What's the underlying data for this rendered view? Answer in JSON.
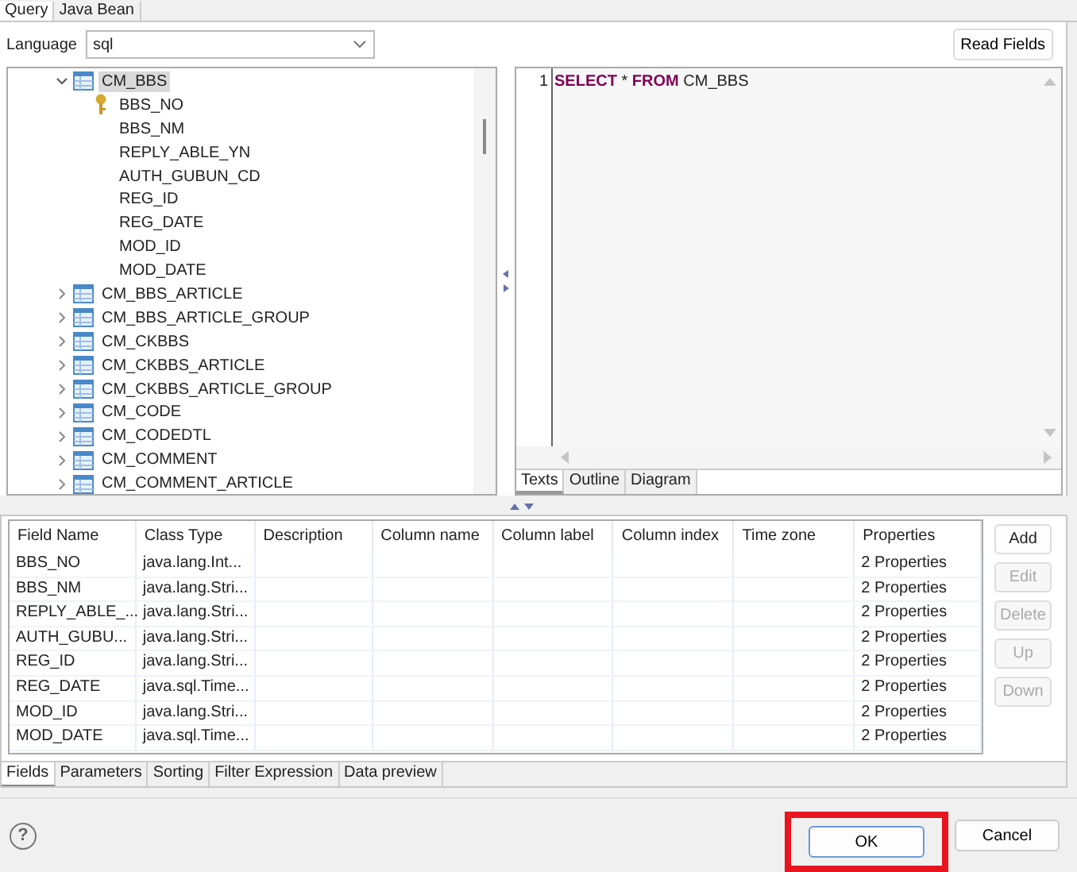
{
  "top_tabs": [
    {
      "label": "Query",
      "selected": true
    },
    {
      "label": "Java Bean",
      "selected": false
    }
  ],
  "language": {
    "label": "Language",
    "value": "sql"
  },
  "read_fields_button": "Read Fields",
  "tree": [
    {
      "label": "CM_BBS",
      "kind": "table",
      "expanded": true,
      "selected": true,
      "children": [
        {
          "label": "BBS_NO",
          "kind": "column",
          "key": true
        },
        {
          "label": "BBS_NM",
          "kind": "column",
          "key": false
        },
        {
          "label": "REPLY_ABLE_YN",
          "kind": "column",
          "key": false
        },
        {
          "label": "AUTH_GUBUN_CD",
          "kind": "column",
          "key": false
        },
        {
          "label": "REG_ID",
          "kind": "column",
          "key": false
        },
        {
          "label": "REG_DATE",
          "kind": "column",
          "key": false
        },
        {
          "label": "MOD_ID",
          "kind": "column",
          "key": false
        },
        {
          "label": "MOD_DATE",
          "kind": "column",
          "key": false
        }
      ]
    },
    {
      "label": "CM_BBS_ARTICLE",
      "kind": "table",
      "expanded": false,
      "selected": false
    },
    {
      "label": "CM_BBS_ARTICLE_GROUP",
      "kind": "table",
      "expanded": false,
      "selected": false
    },
    {
      "label": "CM_CKBBS",
      "kind": "table",
      "expanded": false,
      "selected": false
    },
    {
      "label": "CM_CKBBS_ARTICLE",
      "kind": "table",
      "expanded": false,
      "selected": false
    },
    {
      "label": "CM_CKBBS_ARTICLE_GROUP",
      "kind": "table",
      "expanded": false,
      "selected": false
    },
    {
      "label": "CM_CODE",
      "kind": "table",
      "expanded": false,
      "selected": false
    },
    {
      "label": "CM_CODEDTL",
      "kind": "table",
      "expanded": false,
      "selected": false
    },
    {
      "label": "CM_COMMENT",
      "kind": "table",
      "expanded": false,
      "selected": false
    },
    {
      "label": "CM_COMMENT_ARTICLE",
      "kind": "table",
      "expanded": false,
      "selected": false
    }
  ],
  "editor": {
    "lines": [
      {
        "number": "1",
        "tokens": [
          {
            "text": "SELECT",
            "kind": "keyword"
          },
          {
            "text": " * ",
            "kind": "plain"
          },
          {
            "text": "FROM",
            "kind": "keyword"
          },
          {
            "text": " CM_BBS",
            "kind": "plain"
          }
        ]
      }
    ],
    "tabs": [
      {
        "label": "Texts",
        "selected": true
      },
      {
        "label": "Outline",
        "selected": false
      },
      {
        "label": "Diagram",
        "selected": false
      }
    ]
  },
  "fields_table": {
    "columns": [
      "Field Name",
      "Class Type",
      "Description",
      "Column name",
      "Column label",
      "Column index",
      "Time zone",
      "Properties"
    ],
    "rows": [
      [
        "BBS_NO",
        "java.lang.Int...",
        "",
        "",
        "",
        "",
        "",
        "2 Properties"
      ],
      [
        "BBS_NM",
        "java.lang.Stri...",
        "",
        "",
        "",
        "",
        "",
        "2 Properties"
      ],
      [
        "REPLY_ABLE_...",
        "java.lang.Stri...",
        "",
        "",
        "",
        "",
        "",
        "2 Properties"
      ],
      [
        "AUTH_GUBU...",
        "java.lang.Stri...",
        "",
        "",
        "",
        "",
        "",
        "2 Properties"
      ],
      [
        "REG_ID",
        "java.lang.Stri...",
        "",
        "",
        "",
        "",
        "",
        "2 Properties"
      ],
      [
        "REG_DATE",
        "java.sql.Time...",
        "",
        "",
        "",
        "",
        "",
        "2 Properties"
      ],
      [
        "MOD_ID",
        "java.lang.Stri...",
        "",
        "",
        "",
        "",
        "",
        "2 Properties"
      ],
      [
        "MOD_DATE",
        "java.sql.Time...",
        "",
        "",
        "",
        "",
        "",
        "2 Properties"
      ]
    ]
  },
  "side_buttons": [
    {
      "label": "Add",
      "disabled": false
    },
    {
      "label": "Edit",
      "disabled": true
    },
    {
      "label": "Delete",
      "disabled": true
    },
    {
      "label": "Up",
      "disabled": true
    },
    {
      "label": "Down",
      "disabled": true
    }
  ],
  "bottom_tabs": [
    {
      "label": "Fields",
      "selected": true
    },
    {
      "label": "Parameters",
      "selected": false
    },
    {
      "label": "Sorting",
      "selected": false
    },
    {
      "label": "Filter Expression",
      "selected": false
    },
    {
      "label": "Data preview",
      "selected": false
    }
  ],
  "footer": {
    "help": "?",
    "buttons": [
      {
        "label": "OK",
        "highlighted": true
      },
      {
        "label": "Cancel",
        "highlighted": false
      }
    ]
  }
}
